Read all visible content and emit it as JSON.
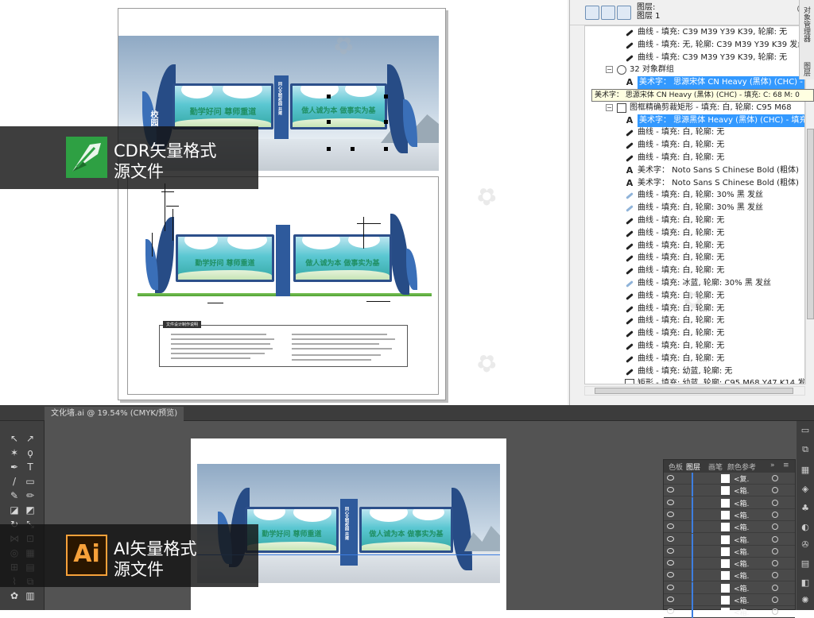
{
  "cdr_badge": {
    "line1": "CDR矢量格式",
    "line2": "源文件"
  },
  "ai_badge": {
    "line1": "AI矢量格式",
    "line2": "源文件",
    "logo_text": "Ai"
  },
  "design": {
    "left_slogan": "勤学好问 尊师重道",
    "right_slogan": "做人诚为本 做事实为基",
    "vertical_text": "同心文明校园 共建",
    "side_text": "校园",
    "notes_title": "文件设计制作说明"
  },
  "object_manager": {
    "layer_labels": [
      "图层:",
      "图层 1"
    ],
    "tooltip": "美术字： 思源宋体 CN Heavy (黑体) (CHC) - 填充: C: 68 M: 0",
    "side_tabs": [
      "对象管理器",
      "图层"
    ],
    "rows": [
      {
        "kind": "curve",
        "indent": 2,
        "text": "曲线 - 填充: C39 M39 Y39 K39, 轮廓: 无"
      },
      {
        "kind": "curve",
        "indent": 2,
        "text": "曲线 - 填充: 无, 轮廓: C39 M39 Y39 K39 发丝"
      },
      {
        "kind": "curve",
        "indent": 2,
        "text": "曲线 - 填充: C39 M39 Y39 K39, 轮廓: 无"
      },
      {
        "kind": "group",
        "indent": 1,
        "text": "32 对象群组"
      },
      {
        "kind": "text",
        "indent": 2,
        "text": "美术字： 思源宋体 CN Heavy (黑体) (CHC) - 填充",
        "selected": true
      },
      {
        "kind": "text",
        "indent": 2,
        "text": ""
      },
      {
        "kind": "rect",
        "indent": 1,
        "text": "图框精确剪裁矩形 - 填充: 白, 轮廓: C95 M68"
      },
      {
        "kind": "text",
        "indent": 2,
        "text": "美术字： 思源黑体 Heavy (黑体) (CHC) - 填充",
        "selected": true
      },
      {
        "kind": "curve",
        "indent": 2,
        "text": "曲线 - 填充: 白, 轮廓: 无"
      },
      {
        "kind": "curve",
        "indent": 2,
        "text": "曲线 - 填充: 白, 轮廓: 无"
      },
      {
        "kind": "curve",
        "indent": 2,
        "text": "曲线 - 填充: 白, 轮廓: 无"
      },
      {
        "kind": "text",
        "indent": 2,
        "text": "美术字： Noto Sans S Chinese Bold (粗体)"
      },
      {
        "kind": "text",
        "indent": 2,
        "text": "美术字： Noto Sans S Chinese Bold (粗体)"
      },
      {
        "kind": "curvelight",
        "indent": 2,
        "text": "曲线 - 填充: 白, 轮廓: 30% 黑 发丝"
      },
      {
        "kind": "curvelight",
        "indent": 2,
        "text": "曲线 - 填充: 白, 轮廓: 30% 黑 发丝"
      },
      {
        "kind": "curve",
        "indent": 2,
        "text": "曲线 - 填充: 白, 轮廓: 无"
      },
      {
        "kind": "curve",
        "indent": 2,
        "text": "曲线 - 填充: 白, 轮廓: 无"
      },
      {
        "kind": "curve",
        "indent": 2,
        "text": "曲线 - 填充: 白, 轮廓: 无"
      },
      {
        "kind": "curve",
        "indent": 2,
        "text": "曲线 - 填充: 白, 轮廓: 无"
      },
      {
        "kind": "curve",
        "indent": 2,
        "text": "曲线 - 填充: 白, 轮廓: 无"
      },
      {
        "kind": "curvelight",
        "indent": 2,
        "text": "曲线 - 填充: 冰蓝, 轮廓: 30% 黑 发丝"
      },
      {
        "kind": "curve",
        "indent": 2,
        "text": "曲线 - 填充: 白, 轮廓: 无"
      },
      {
        "kind": "curve",
        "indent": 2,
        "text": "曲线 - 填充: 白, 轮廓: 无"
      },
      {
        "kind": "curve",
        "indent": 2,
        "text": "曲线 - 填充: 白, 轮廓: 无"
      },
      {
        "kind": "curve",
        "indent": 2,
        "text": "曲线 - 填充: 白, 轮廓: 无"
      },
      {
        "kind": "curve",
        "indent": 2,
        "text": "曲线 - 填充: 白, 轮廓: 无"
      },
      {
        "kind": "curve",
        "indent": 2,
        "text": "曲线 - 填充: 白, 轮廓: 无"
      },
      {
        "kind": "curve",
        "indent": 2,
        "text": "曲线 - 填充: 幼蓝, 轮廓: 无"
      },
      {
        "kind": "rect",
        "indent": 2,
        "text": "矩形 - 填充: 幼蓝, 轮廓: C95 M68 Y47 K14 发"
      }
    ]
  },
  "illustrator": {
    "doc_tab": "文化墙.ai @ 19.54% (CMYK/预览)",
    "layers_tabs": [
      "色板",
      "图层",
      "画笔",
      "颜色参考"
    ],
    "layer_rows": [
      "<复.",
      "<箱.",
      "<箱.",
      "<箱.",
      "<箱.",
      "<箱.",
      "<箱.",
      "<箱.",
      "<箱.",
      "<箱.",
      "<箱.",
      "<箱."
    ]
  },
  "colors": {
    "accent_blue": "#3399ff",
    "board_green": "#35a9a6",
    "frame_blue": "#2c4f8a",
    "ai_orange": "#f7a13a",
    "cdr_green": "#2ea043"
  }
}
